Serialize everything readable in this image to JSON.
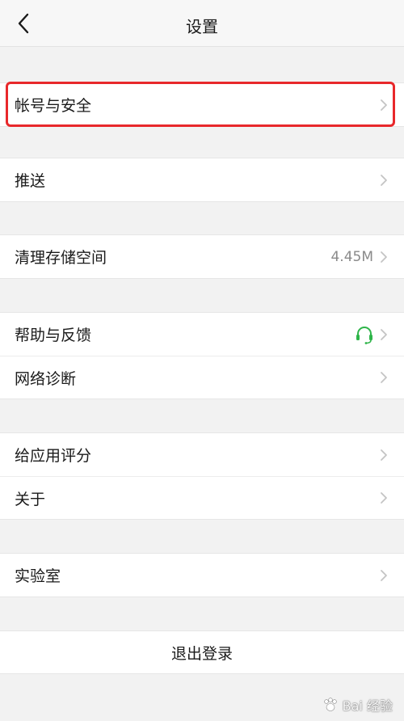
{
  "navbar": {
    "title": "设置",
    "back_icon": "chevron-left-icon"
  },
  "groups": [
    {
      "items": [
        {
          "label": "帐号与安全"
        }
      ]
    },
    {
      "items": [
        {
          "label": "推送"
        }
      ]
    },
    {
      "items": [
        {
          "label": "清理存储空间",
          "value": "4.45M"
        }
      ]
    },
    {
      "items": [
        {
          "label": "帮助与反馈",
          "icon": "headset-icon"
        },
        {
          "label": "网络诊断"
        }
      ]
    },
    {
      "items": [
        {
          "label": "给应用评分"
        },
        {
          "label": "关于"
        }
      ]
    },
    {
      "items": [
        {
          "label": "实验室"
        }
      ]
    }
  ],
  "logout": {
    "label": "退出登录"
  },
  "watermark": {
    "text": "Bai 经验"
  },
  "colors": {
    "highlight": "#e8282b",
    "support_icon": "#2fb54a",
    "chevron": "#c4c4c4"
  }
}
